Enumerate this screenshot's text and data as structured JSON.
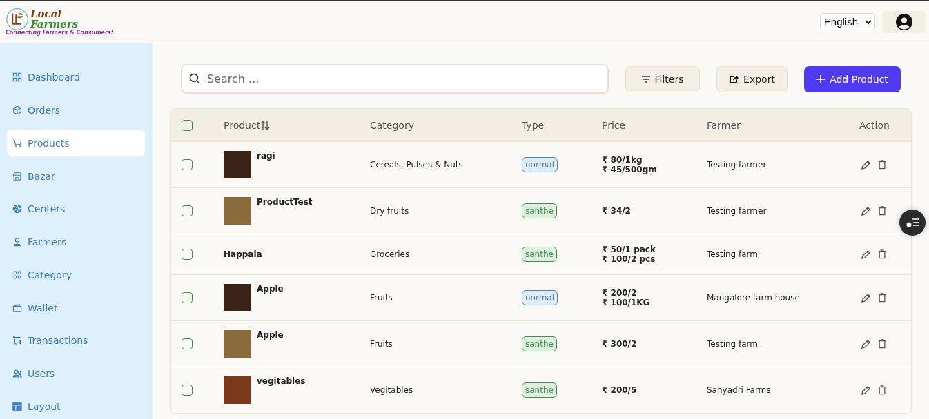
{
  "header": {
    "logo": {
      "title_line1": "Local",
      "title_line2": "Farmers",
      "tagline": "Connecting Farmers & Consumers!"
    },
    "language": "English"
  },
  "sidebar": {
    "items": [
      {
        "label": "Dashboard",
        "selected": false
      },
      {
        "label": "Orders",
        "selected": false
      },
      {
        "label": "Products",
        "selected": true
      },
      {
        "label": "Bazar",
        "selected": false
      },
      {
        "label": "Centers",
        "selected": false
      },
      {
        "label": "Farmers",
        "selected": false
      },
      {
        "label": "Category",
        "selected": false
      },
      {
        "label": "Wallet",
        "selected": false
      },
      {
        "label": "Transactions",
        "selected": false
      },
      {
        "label": "Users",
        "selected": false
      },
      {
        "label": "Layout",
        "selected": false
      }
    ]
  },
  "toolbar": {
    "search": {
      "placeholder": "Search ..."
    },
    "filters": "Filters",
    "export": "Export",
    "add": "Add Product"
  },
  "table": {
    "all_checked": false,
    "columns": [
      "Product",
      "Category",
      "Type",
      "Price",
      "Farmer",
      "Action"
    ],
    "rows": [
      {
        "checked": false,
        "image": true,
        "product": "ragi",
        "category": "Cereals, Pulses & Nuts",
        "type": {
          "label": "normal",
          "color": "#3b86d4"
        },
        "prices": [
          "₹ 80/1kg",
          "₹ 45/500gm"
        ],
        "farmer": "Testing farmer"
      },
      {
        "checked": false,
        "image": true,
        "product": "ProductTest",
        "category": "Dry fruits",
        "type": {
          "label": "santhe",
          "color": "#2e9a4e"
        },
        "prices": [
          "₹ 34/2"
        ],
        "farmer": "Testing farmer"
      },
      {
        "checked": false,
        "image": false,
        "product": "Happala",
        "category": "Groceries",
        "type": {
          "label": "santhe",
          "color": "#2e9a4e"
        },
        "prices": [
          "₹ 50/1 pack",
          "₹ 100/2 pcs"
        ],
        "farmer": "Testing farm"
      },
      {
        "checked": false,
        "image": true,
        "product": "Apple",
        "category": "Fruits",
        "type": {
          "label": "normal",
          "color": "#3b86d4"
        },
        "prices": [
          "₹ 200/2",
          "₹ 100/1KG"
        ],
        "farmer": "Mangalore farm house"
      },
      {
        "checked": false,
        "image": true,
        "product": "Apple",
        "category": "Fruits",
        "type": {
          "label": "santhe",
          "color": "#2e9a4e"
        },
        "prices": [
          "₹ 300/2"
        ],
        "farmer": "Testing farm"
      },
      {
        "checked": false,
        "image": true,
        "product": "vegitables",
        "category": "Vegitables",
        "type": {
          "label": "santhe",
          "color": "#2e9a4e"
        },
        "prices": [
          "₹ 200/5"
        ],
        "farmer": "Sahyadri Farms"
      }
    ]
  }
}
